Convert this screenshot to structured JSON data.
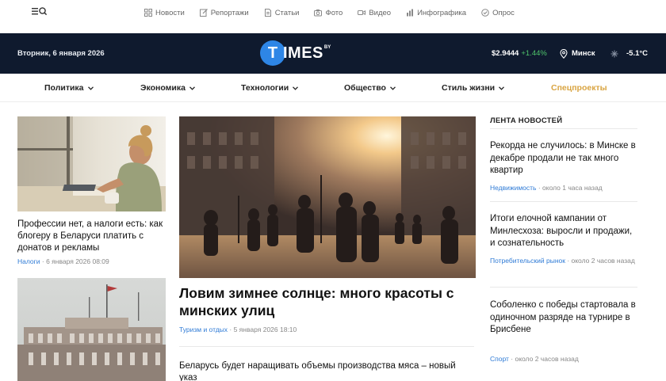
{
  "topnav": {
    "items": [
      {
        "label": "Новости",
        "icon": "grid-icon"
      },
      {
        "label": "Репортажи",
        "icon": "pencil-icon"
      },
      {
        "label": "Статьи",
        "icon": "document-icon"
      },
      {
        "label": "Фото",
        "icon": "camera-icon"
      },
      {
        "label": "Видео",
        "icon": "video-icon"
      },
      {
        "label": "Инфографика",
        "icon": "chart-icon"
      },
      {
        "label": "Опрос",
        "icon": "check-circle-icon"
      }
    ]
  },
  "header": {
    "date": "Вторник, 6 января 2026",
    "logo_letter": "T",
    "logo_text": "IMES",
    "logo_sup": "BY",
    "rate_value": "$2.9444",
    "rate_change": "+1.44%",
    "city": "Минск",
    "temperature": "-5.1°C",
    "colors": {
      "header_bg": "#0f1a2e",
      "logo_blue": "#2e86e6",
      "rate_up": "#4fc36b",
      "special": "#d9a441",
      "link": "#2f7bd6"
    }
  },
  "categories": [
    {
      "label": "Политика",
      "dropdown": true
    },
    {
      "label": "Экономика",
      "dropdown": true
    },
    {
      "label": "Технологии",
      "dropdown": true
    },
    {
      "label": "Общество",
      "dropdown": true
    },
    {
      "label": "Стиль жизни",
      "dropdown": true
    },
    {
      "label": "Спецпроекты",
      "dropdown": false
    }
  ],
  "left_cards": [
    {
      "title": "Профессии нет, а налоги есть: как блогеру в Беларуси платить с донатов и рекламы",
      "category": "Налоги",
      "date": "6 января 2026 08:09"
    },
    {
      "title": "",
      "category": "",
      "date": ""
    }
  ],
  "main": {
    "title": "Ловим зимнее солнце: много красоты с минских улиц",
    "category": "Туризм и отдых",
    "date": "5 января 2026 18:10",
    "second_title": "Беларусь будет наращивать объемы производства мяса – новый указ"
  },
  "feed": {
    "heading": "ЛЕНТА НОВОСТЕЙ",
    "items": [
      {
        "title": "Рекорда не случилось: в Минске в декабре продали не так много квартир",
        "category": "Недвижимость",
        "time": "около 1 часа назад"
      },
      {
        "title": "Итоги елочной кампании от Минлесхоза: выросли и продажи, и сознательность",
        "category": "Потребительский рынок",
        "time": "около 2 часов назад"
      },
      {
        "title": "Соболенко с победы стартовала в одиночном разряде на турнире в Брисбене",
        "category": "Спорт",
        "time": "около 2 часов назад"
      }
    ]
  }
}
